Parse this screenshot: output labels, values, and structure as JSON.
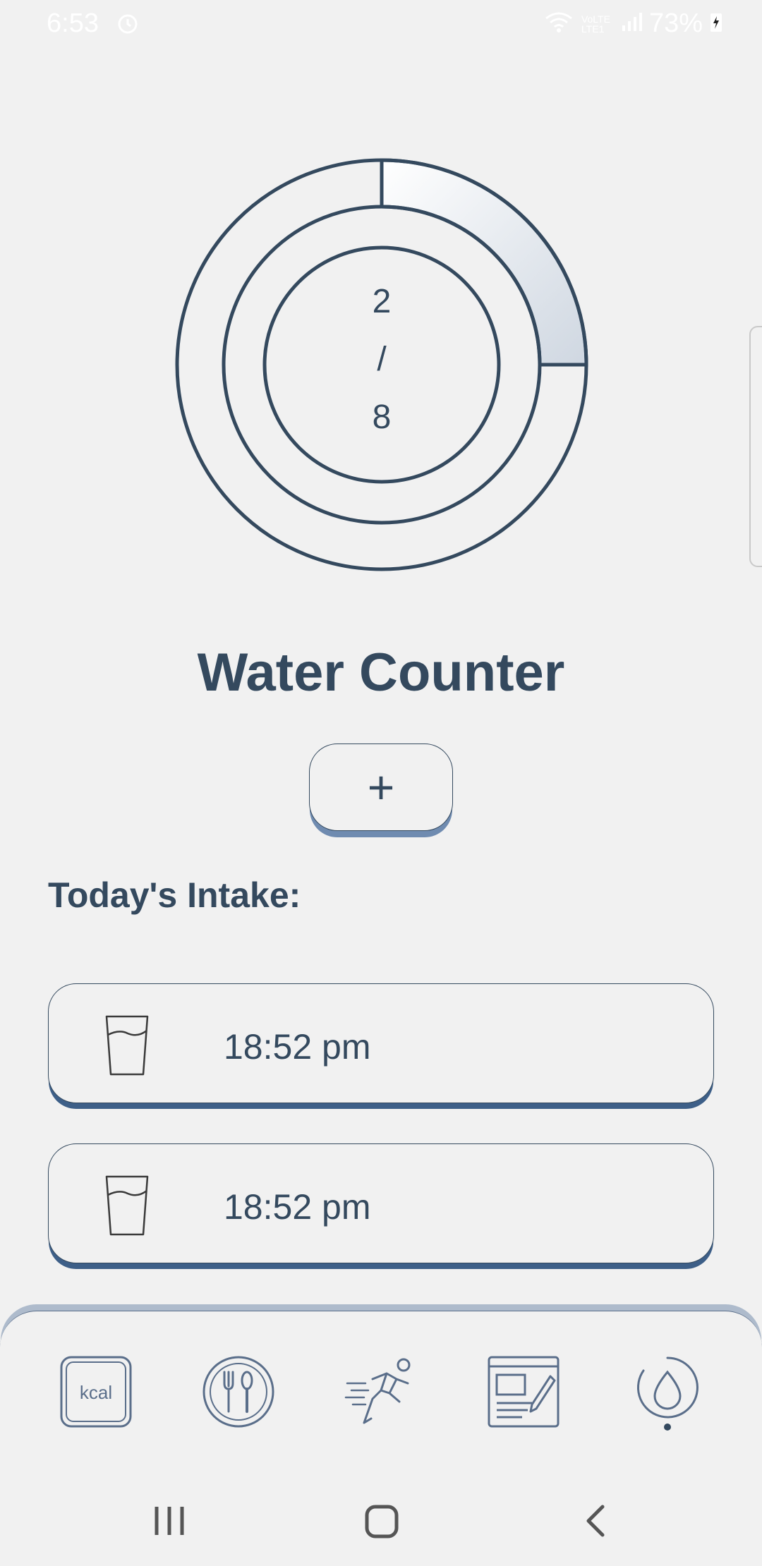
{
  "status_bar": {
    "time": "6:53",
    "network": "VoLTE LTE1",
    "battery": "73%"
  },
  "progress": {
    "current": "2",
    "separator": "/",
    "goal": "8",
    "fraction": 0.25
  },
  "title": "Water Counter",
  "add_button": {
    "label": "+"
  },
  "intake": {
    "heading": "Today's Intake:",
    "entries": [
      {
        "time": "18:52 pm",
        "icon": "water-glass-icon"
      },
      {
        "time": "18:52 pm",
        "icon": "water-glass-icon"
      }
    ]
  },
  "bottom_nav": {
    "items": [
      {
        "name": "calories",
        "icon": "kcal-icon",
        "label": "kcal"
      },
      {
        "name": "meals",
        "icon": "plate-utensils-icon"
      },
      {
        "name": "exercise",
        "icon": "running-person-icon"
      },
      {
        "name": "notes",
        "icon": "notepad-pencil-icon"
      },
      {
        "name": "water",
        "icon": "water-drop-icon",
        "active": true
      }
    ]
  },
  "colors": {
    "primary": "#34495e",
    "background": "#f1f1f1",
    "accent": "#3d5f88"
  }
}
